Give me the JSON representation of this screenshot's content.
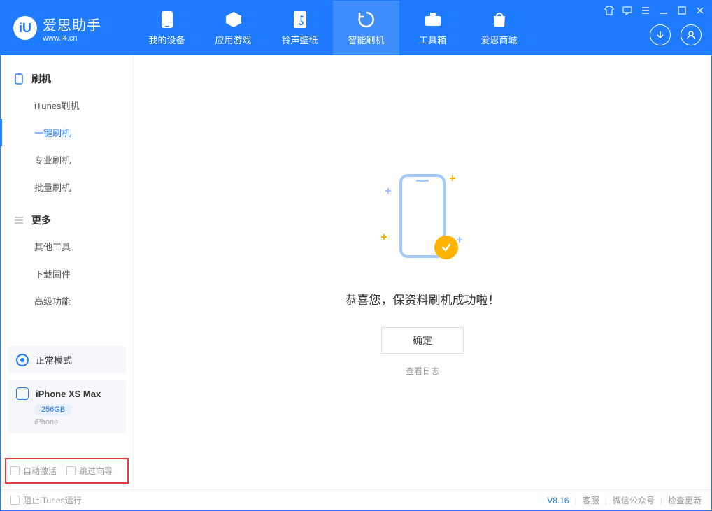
{
  "app": {
    "title": "爱思助手",
    "subtitle": "www.i4.cn"
  },
  "tabs": {
    "device": "我的设备",
    "apps": "应用游戏",
    "ringtone": "铃声壁纸",
    "flash": "智能刷机",
    "toolbox": "工具箱",
    "store": "爱思商城"
  },
  "sidebar": {
    "group_flash": "刷机",
    "items_flash": {
      "itunes": "iTunes刷机",
      "onekey": "一键刷机",
      "pro": "专业刷机",
      "batch": "批量刷机"
    },
    "group_more": "更多",
    "items_more": {
      "other": "其他工具",
      "firmware": "下载固件",
      "advanced": "高级功能"
    }
  },
  "device": {
    "mode": "正常模式",
    "name": "iPhone XS Max",
    "storage": "256GB",
    "type": "iPhone"
  },
  "checks": {
    "auto_activate": "自动激活",
    "skip_guide": "跳过向导"
  },
  "main": {
    "success": "恭喜您，保资料刷机成功啦！",
    "ok": "确定",
    "view_log": "查看日志"
  },
  "footer": {
    "block_itunes": "阻止iTunes运行",
    "version": "V8.16",
    "service": "客服",
    "wechat": "微信公众号",
    "update": "检查更新"
  }
}
